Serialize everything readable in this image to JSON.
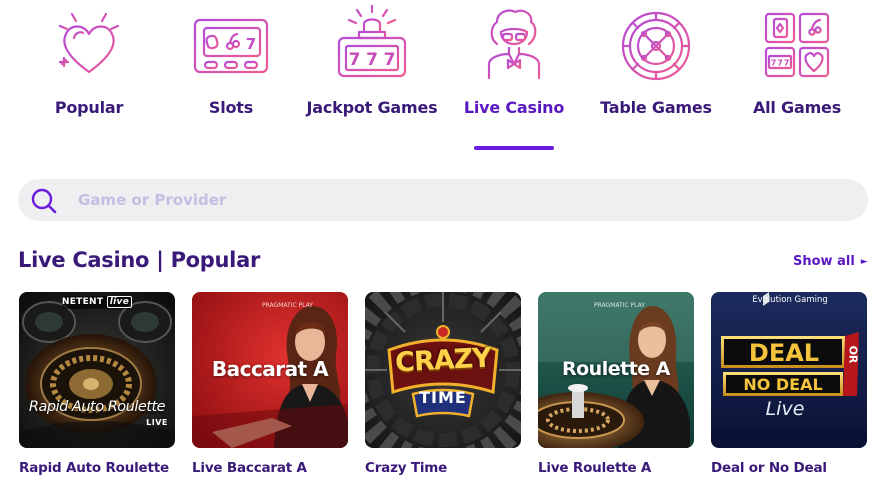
{
  "categories": [
    {
      "label": "Popular",
      "icon": "heart-icon",
      "active": false
    },
    {
      "label": "Slots",
      "icon": "slot-machine-icon",
      "active": false
    },
    {
      "label": "Jackpot Games",
      "icon": "jackpot-icon",
      "active": false
    },
    {
      "label": "Live Casino",
      "icon": "dealer-icon",
      "active": true
    },
    {
      "label": "Table Games",
      "icon": "roulette-wheel-icon",
      "active": false
    },
    {
      "label": "All Games",
      "icon": "all-games-grid-icon",
      "active": false
    }
  ],
  "slot_digits": "7",
  "search": {
    "placeholder": "Game or Provider",
    "value": ""
  },
  "section": {
    "title": "Live Casino | Popular",
    "show_all": "Show all"
  },
  "games": [
    {
      "name": "Rapid Auto Roulette",
      "provider": "NETENT",
      "badge": "live",
      "art_title": "Rapid Auto Roulette",
      "art_sub": "LIVE"
    },
    {
      "name": "Live Baccarat A",
      "provider": "PRAGMATIC PLAY",
      "art_title": "Baccarat A"
    },
    {
      "name": "Crazy Time",
      "art_title": "CRAZY",
      "art_sub": "TIME"
    },
    {
      "name": "Live Roulette A",
      "provider": "PRAGMATIC PLAY",
      "art_title": "Roulette A"
    },
    {
      "name": "Deal or No Deal",
      "provider": "Evolution Gaming",
      "art_title": "DEAL",
      "art_or": "OR",
      "art_mid": "NO DEAL",
      "art_sub": "Live"
    }
  ],
  "colors": {
    "brand_purple": "#3a1a78",
    "accent": "#6a1bdc",
    "icon_gradient_start": "#c44bd8",
    "icon_gradient_end": "#e8529a",
    "search_bg": "#efeef1"
  }
}
